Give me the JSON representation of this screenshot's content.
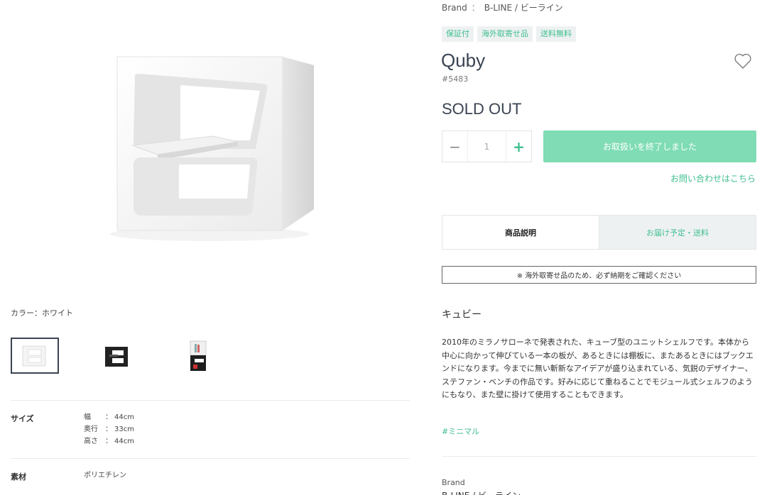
{
  "product": {
    "brand_label": "Brand",
    "brand_sep": "：",
    "brand_value": "B-LINE / ビーライン",
    "badges": [
      "保証付",
      "海外取寄せ品",
      "送料無料"
    ],
    "title": "Quby",
    "code": "#5483",
    "price_status": "SOLD OUT"
  },
  "purchase": {
    "qty_minus": "−",
    "qty_value": "1",
    "qty_plus": "+",
    "cart_button": "お取扱いを終了しました",
    "inquiry_link": "お問い合わせはこちら"
  },
  "tabs": [
    {
      "label": "商品説明",
      "active": true
    },
    {
      "label": "お届け予定・送料",
      "active": false
    }
  ],
  "notice": "※ 海外取寄せ品のため、必ず納期をご確認ください",
  "description": {
    "subtitle": "キュビー",
    "body": "2010年のミラノサローネで発表された、キューブ型のユニットシェルフです。本体から中心に向かって伸びている一本の板が、あるときには棚板に、またあるときにはブックエンドになります。今までに無い斬新なアイデアが盛り込まれている、気鋭のデザイナー、ステファン・ベンチの作品です。好みに応じて重ねることでモジュール式シェルフのようにもなり、また壁に掛けて使用することもできます。",
    "tag": "#ミニマル",
    "brand_footer": "Brand",
    "brand_footer_value": "B-LINE / ビーライン"
  },
  "gallery": {
    "color_label": "カラー：ホワイト",
    "thumbnails": [
      "white",
      "black",
      "stacked"
    ]
  },
  "specs": {
    "size_key": "サイズ",
    "size_rows": [
      {
        "k": "幅",
        "c": "：",
        "v": "44cm"
      },
      {
        "k": "奥行",
        "c": "：",
        "v": "33cm"
      },
      {
        "k": "高さ",
        "c": "：",
        "v": "44cm"
      }
    ],
    "material_key": "素材",
    "material_value": "ポリエチレン"
  },
  "colors": {
    "accent": "#3fbf8f",
    "button_disabled": "#7fdcb4",
    "text_dark": "#3a4452"
  }
}
